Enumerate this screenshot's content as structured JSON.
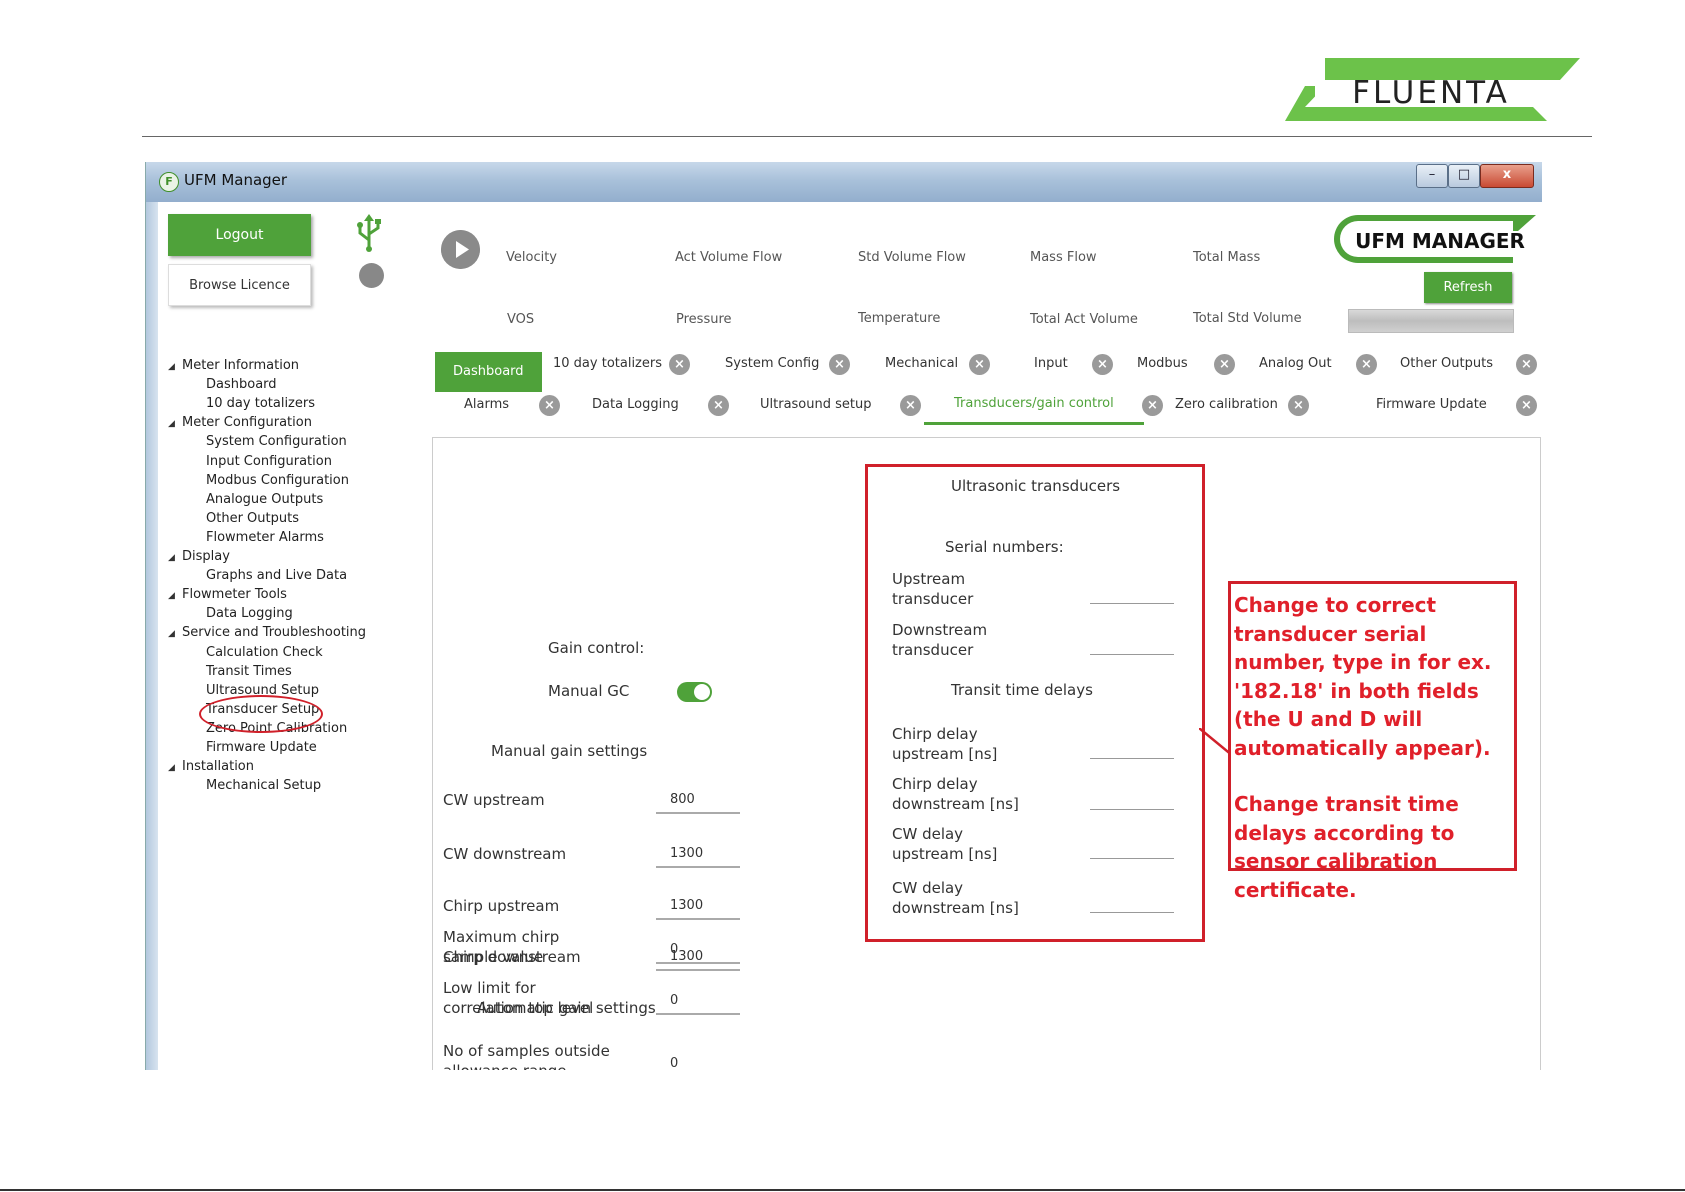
{
  "brand": {
    "name": "FLUENTA"
  },
  "window": {
    "title": "UFM Manager",
    "controls": {
      "minimize": "–",
      "maximize": "□",
      "close": "x"
    }
  },
  "left": {
    "logout_label": "Logout",
    "browse_label": "Browse Licence"
  },
  "tree": [
    {
      "label": "Meter Information",
      "level": 1
    },
    {
      "label": "Dashboard",
      "level": 2
    },
    {
      "label": "10 day totalizers",
      "level": 2
    },
    {
      "label": "Meter Configuration",
      "level": 1
    },
    {
      "label": "System Configuration",
      "level": 2
    },
    {
      "label": "Input Configuration",
      "level": 2
    },
    {
      "label": "Modbus Configuration",
      "level": 2
    },
    {
      "label": "Analogue Outputs",
      "level": 2
    },
    {
      "label": "Other Outputs",
      "level": 2
    },
    {
      "label": "Flowmeter Alarms",
      "level": 2
    },
    {
      "label": "Display",
      "level": 1
    },
    {
      "label": "Graphs and Live Data",
      "level": 2
    },
    {
      "label": "Flowmeter Tools",
      "level": 1
    },
    {
      "label": "Data Logging",
      "level": 2
    },
    {
      "label": "Service and Troubleshooting",
      "level": 1
    },
    {
      "label": "Calculation Check",
      "level": 2
    },
    {
      "label": "Transit Times",
      "level": 2
    },
    {
      "label": "Ultrasound Setup",
      "level": 2
    },
    {
      "label": "Transducer Setup",
      "level": 2
    },
    {
      "label": "Zero Point Calibration",
      "level": 2
    },
    {
      "label": "Firmware Update",
      "level": 2
    },
    {
      "label": "Installation",
      "level": 1
    },
    {
      "label": "Mechanical Setup",
      "level": 2
    }
  ],
  "readouts": {
    "row1": [
      "Velocity",
      "Act Volume Flow",
      "Std Volume Flow",
      "Mass Flow",
      "Total Mass"
    ],
    "row2": [
      "VOS",
      "Pressure",
      "Temperature",
      "Total Act Volume",
      "Total Std Volume"
    ]
  },
  "ufm_logo": "UFM MANAGER",
  "refresh_label": "Refresh",
  "tabs_row1": [
    "Dashboard",
    "10 day totalizers",
    "System Config",
    "Mechanical",
    "Input",
    "Modbus",
    "Analog Out",
    "Other Outputs"
  ],
  "tabs_row2": [
    "Alarms",
    "Data Logging",
    "Ultrasound setup",
    "Transducers/gain control",
    "Zero calibration",
    "Firmware Update"
  ],
  "gain": {
    "heading": "Gain control:",
    "manual_gc_label": "Manual GC",
    "manual_gc_on": true,
    "manual_heading": "Manual gain settings",
    "cw_upstream_label": "CW upstream",
    "cw_upstream": "800",
    "cw_downstream_label": "CW downstream",
    "cw_downstream": "1300",
    "chirp_upstream_label": "Chirp upstream",
    "chirp_upstream": "1300",
    "chirp_downstream_label": "Chirp downstream",
    "chirp_downstream": "1300",
    "auto_heading": "Automatic gain settings",
    "samples_label_1": "No of samples outside",
    "samples_label_2": "allowance range",
    "samples": "0",
    "max_chirp_label_1": "Maximum chirp",
    "max_chirp_label_2": "sample value",
    "max_chirp": "0",
    "low_limit_label_1": "Low limit for",
    "low_limit_label_2": "correlation top level",
    "low_limit": "0"
  },
  "transducers": {
    "heading": "Ultrasonic transducers",
    "serial_heading": "Serial numbers:",
    "upstream_1": "Upstream",
    "upstream_2": "transducer",
    "downstream_1": "Downstream",
    "downstream_2": "transducer",
    "transit_heading": "Transit time delays",
    "chirp_up_1": "Chirp delay",
    "chirp_up_2": "upstream [ns]",
    "chirp_down_1": "Chirp delay",
    "chirp_down_2": "downstream [ns]",
    "cw_up_1": "CW delay",
    "cw_up_2": "upstream [ns]",
    "cw_down_1": "CW delay",
    "cw_down_2": "downstream [ns]"
  },
  "callout": {
    "para1": "Change to correct transducer serial number, type in for ex. '182.18' in both fields (the U and D will automatically appear).",
    "para2": "Change transit time delays according to sensor calibration certificate."
  },
  "colors": {
    "accent_green": "#4fa23a",
    "annotation_red": "#d0202a"
  }
}
